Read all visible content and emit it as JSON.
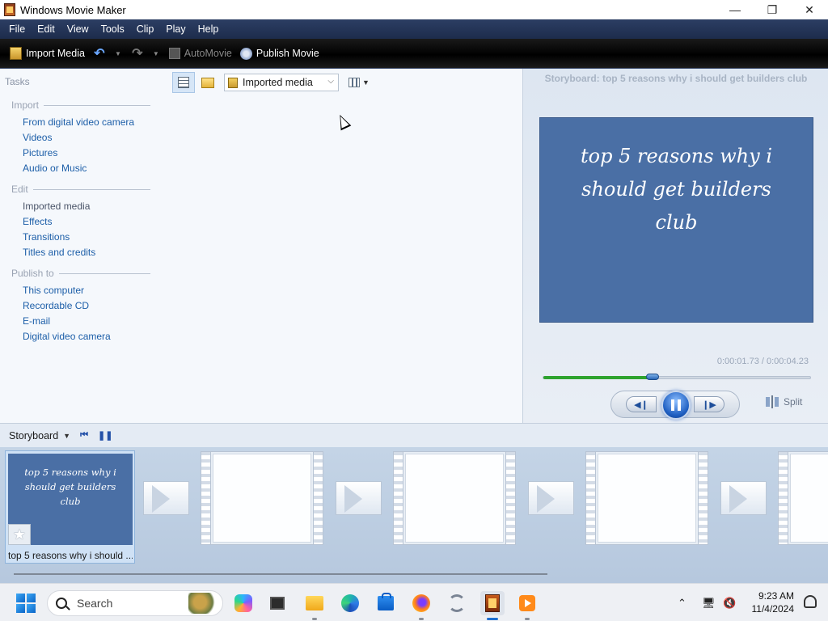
{
  "window": {
    "title": "Windows Movie Maker",
    "minimize": "—",
    "restore": "❐",
    "close": "✕"
  },
  "menu": [
    "File",
    "Edit",
    "View",
    "Tools",
    "Clip",
    "Play",
    "Help"
  ],
  "toolbar": {
    "import_label": "Import Media",
    "automovie_label": "AutoMovie",
    "publish_label": "Publish Movie"
  },
  "tasks": {
    "title": "Tasks",
    "import": {
      "heading": "Import",
      "items": [
        "From digital video camera",
        "Videos",
        "Pictures",
        "Audio or Music"
      ]
    },
    "edit": {
      "heading": "Edit",
      "items": [
        "Imported media",
        "Effects",
        "Transitions",
        "Titles and credits"
      ]
    },
    "publish": {
      "heading": "Publish to",
      "items": [
        "This computer",
        "Recordable CD",
        "E-mail",
        "Digital video camera"
      ]
    }
  },
  "content": {
    "collection": "Imported media"
  },
  "preview": {
    "title": "Storyboard: top 5 reasons why i should get builders club",
    "monitor_text": "top 5 reasons why i should get builders club",
    "time": "0:00:01.73 / 0:00:04.23",
    "progress": 0.41,
    "split_label": "Split"
  },
  "storyboard": {
    "label": "Storyboard",
    "clip": {
      "thumb_text": "top 5 reasons why i should get builders club",
      "caption": "top 5 reasons why i should ..."
    }
  },
  "taskbar": {
    "search_label": "Search",
    "time": "9:23 AM",
    "date": "11/4/2024"
  },
  "icons": [
    "import-media-icon",
    "undo-icon",
    "redo-icon",
    "automovie-icon",
    "publish-movie-icon",
    "folder-icon",
    "pause-icon",
    "split-icon",
    "star-icon",
    "windows-start-icon",
    "search-icon"
  ],
  "colors": {
    "accent": "#1c5ea8",
    "menubar": "#2c3e63",
    "monitor": "#4a6fa5",
    "progress": "#2ea32e"
  }
}
